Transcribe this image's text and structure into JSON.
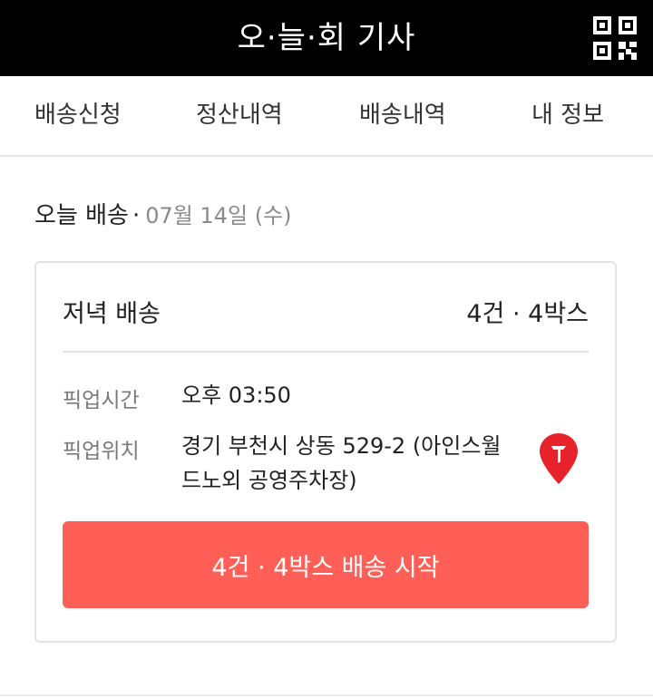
{
  "header": {
    "title": "오·늘·회 기사",
    "qr_icon": "qr-code-icon"
  },
  "nav": {
    "tabs": [
      {
        "label": "배송신청"
      },
      {
        "label": "정산내역"
      },
      {
        "label": "배송내역"
      },
      {
        "label": "내 정보"
      }
    ]
  },
  "delivery_date": {
    "label": "오늘 배송",
    "separator": "·",
    "date": "07월 14일 (수)"
  },
  "card": {
    "title": "저녁 배송",
    "count": "4건 · 4박스",
    "pickup_time_label": "픽업시간",
    "pickup_time_value": "오후 03:50",
    "pickup_location_label": "픽업위치",
    "pickup_location_value": "경기 부천시 상동 529-2 (아인스월드노외 공영주차장)",
    "map_icon": "map-pin-icon",
    "start_button_label": "4건 · 4박스 배송 시작"
  },
  "colors": {
    "header_bg": "#000000",
    "accent": "#ff5f57",
    "pin": "#e8222b"
  }
}
